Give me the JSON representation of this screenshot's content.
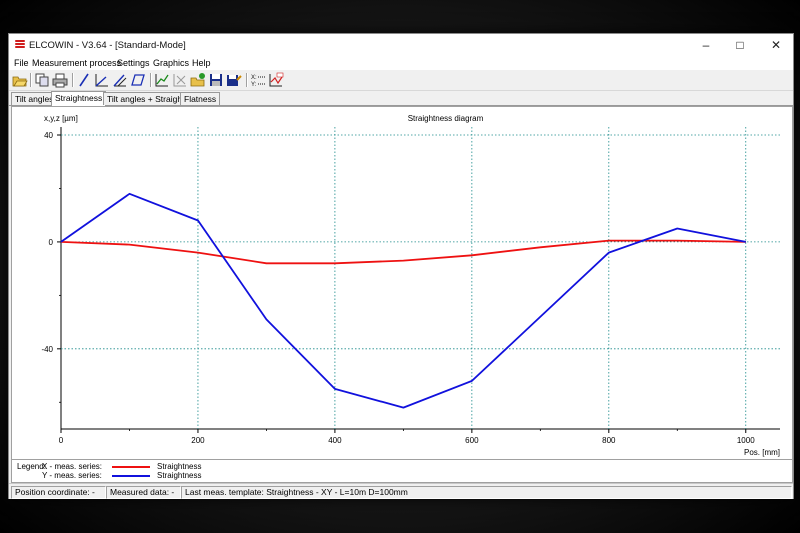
{
  "window": {
    "title": "ELCOWIN - V3.64 - [Standard-Mode]"
  },
  "menu": [
    "File",
    "Measurement process",
    "Settings",
    "Graphics",
    "Help"
  ],
  "toolbar_icons": [
    "open-icon",
    "copy-icon",
    "print-icon",
    "line-tool-icon",
    "angle-icon",
    "angle-edit-icon",
    "parallelogram-icon",
    "chart-add-icon",
    "chart-remove-icon",
    "open-template-icon",
    "save-icon",
    "save-as-icon",
    "x-y-values-icon",
    "graph-settings-icon"
  ],
  "tabs": [
    {
      "label": "Tilt angles",
      "active": false
    },
    {
      "label": "Straightness",
      "active": true
    },
    {
      "label": "Tilt angles + Straightness",
      "active": false
    },
    {
      "label": "Flatness",
      "active": false
    }
  ],
  "chart_data": {
    "type": "line",
    "title": "Straightness diagram",
    "ylabel": "x,y,z [µm]",
    "xlabel": "Pos. [mm]",
    "xlim": [
      0,
      1050
    ],
    "ylim": [
      -70,
      40
    ],
    "xticks": [
      0,
      200,
      400,
      600,
      800,
      1000
    ],
    "yticks": [
      40,
      0,
      -40
    ],
    "grid": true,
    "series": [
      {
        "name": "Straightness",
        "color": "#ee1111",
        "x": [
          0,
          100,
          200,
          300,
          400,
          500,
          600,
          700,
          800,
          900,
          1000
        ],
        "y": [
          0,
          -1,
          -4,
          -8,
          -8,
          -7,
          -5,
          -2,
          0.5,
          0.5,
          0
        ]
      },
      {
        "name": "Straightness",
        "color": "#1111dd",
        "x": [
          0,
          100,
          200,
          300,
          400,
          500,
          600,
          700,
          800,
          900,
          1000
        ],
        "y": [
          0,
          18,
          8,
          -29,
          -55,
          -62,
          -52,
          null,
          -4,
          5,
          0
        ]
      }
    ]
  },
  "legend": {
    "title": "Legend:",
    "rows": [
      {
        "label": "X - meas. series:",
        "name": "Straightness",
        "color": "#ee1111"
      },
      {
        "label": "Y - meas. series:",
        "name": "Straightness",
        "color": "#1111dd"
      }
    ]
  },
  "status": {
    "position": "Position coordinate: -",
    "measured": "Measured data: -",
    "template": "Last meas. template: Straightness - XY - L=10m D=100mm"
  }
}
